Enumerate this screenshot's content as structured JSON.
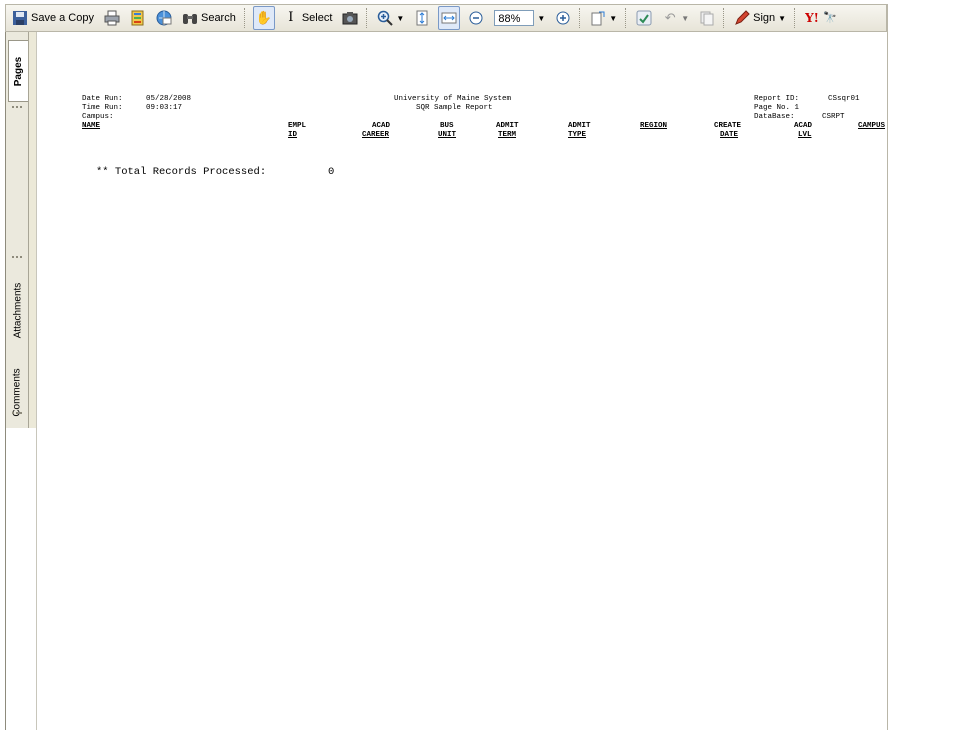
{
  "toolbar": {
    "save_copy_label": "Save a Copy",
    "search_label": "Search",
    "select_label": "Select",
    "zoom_value": "88%",
    "sign_label": "Sign",
    "yahoo_label": "Y!"
  },
  "side_tabs": {
    "pages": "Pages",
    "attachments": "Attachments",
    "comments": "Comments"
  },
  "report": {
    "date_run_label": "Date Run:",
    "date_run_value": "05/28/2008",
    "time_run_label": "Time Run:",
    "time_run_value": "09:03:17",
    "campus_label": "Campus:",
    "title": "University of Maine System",
    "subtitle": "SQR Sample Report",
    "report_id_label": "Report ID:",
    "report_id_value": "CSsqr01",
    "page_no": "Page No. 1",
    "database_label": "DataBase:",
    "database_value": "CSRPT",
    "columns": {
      "name": "NAME",
      "empl_top": "EMPL",
      "empl_bottom": "ID",
      "acad_top": "ACAD",
      "acad_bottom": "CAREER",
      "bus_top": "BUS",
      "bus_bottom": "UNIT",
      "admit_term_top": "ADMIT",
      "admit_term_bottom": "TERM",
      "admit_type_top": "ADMIT",
      "admit_type_bottom": "TYPE",
      "region": "REGION",
      "create_top": "CREATE",
      "create_bottom": "DATE",
      "acad_lvl_top": "ACAD",
      "acad_lvl_bottom": "LVL",
      "campus": "CAMPUS"
    },
    "total_label": "** Total Records Processed:",
    "total_value": "0"
  }
}
